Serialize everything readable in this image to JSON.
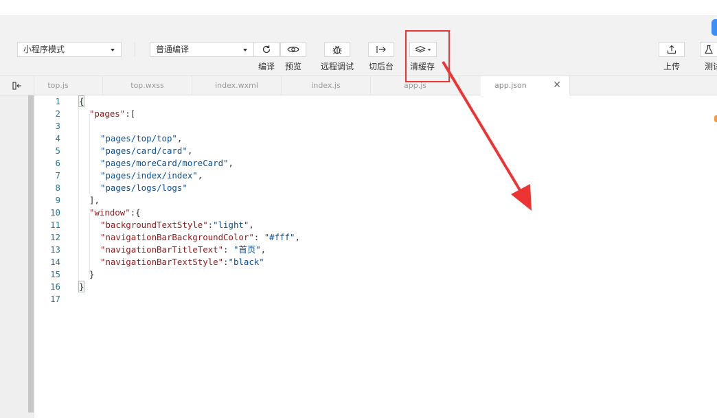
{
  "toolbar": {
    "mode_select": "小程序模式",
    "compile_select": "普通编译",
    "buttons": {
      "compile": "编译",
      "preview": "预览",
      "remote_debug": "远程调试",
      "background": "切后台",
      "clear_cache": "清缓存",
      "upload": "上传",
      "test": "测试"
    }
  },
  "tabs": [
    {
      "label": "top.js"
    },
    {
      "label": "top.wxss"
    },
    {
      "label": "index.wxml"
    },
    {
      "label": "index.js"
    },
    {
      "label": "app.js"
    },
    {
      "label": "app.json",
      "active": true
    }
  ],
  "editor": {
    "lines": [
      {
        "num": "1",
        "text": "{"
      },
      {
        "num": "2",
        "key": "\"pages\"",
        "rest": ":["
      },
      {
        "num": "3",
        "text": ""
      },
      {
        "num": "4",
        "str": "\"pages/top/top\"",
        "rest": ","
      },
      {
        "num": "5",
        "str": "\"pages/card/card\"",
        "rest": ","
      },
      {
        "num": "6",
        "str": "\"pages/moreCard/moreCard\"",
        "rest": ","
      },
      {
        "num": "7",
        "str": "\"pages/index/index\"",
        "rest": ","
      },
      {
        "num": "8",
        "str": "\"pages/logs/logs\"",
        "rest": ""
      },
      {
        "num": "9",
        "text": "],"
      },
      {
        "num": "10",
        "key": "\"window\"",
        "rest": ":{"
      },
      {
        "num": "11",
        "key": "\"backgroundTextStyle\"",
        "sep": ":",
        "str": "\"light\"",
        "rest": ","
      },
      {
        "num": "12",
        "key": "\"navigationBarBackgroundColor\"",
        "sep": ": ",
        "str": "\"#fff\"",
        "rest": ","
      },
      {
        "num": "13",
        "key": "\"navigationBarTitleText\"",
        "sep": ": ",
        "str": "\"首页\"",
        "rest": ","
      },
      {
        "num": "14",
        "key": "\"navigationBarTextStyle\"",
        "sep": ":",
        "str": "\"black\"",
        "rest": ""
      },
      {
        "num": "15",
        "text": "}"
      },
      {
        "num": "16",
        "text": "}"
      },
      {
        "num": "17",
        "text": ""
      }
    ]
  },
  "colors": {
    "annotation": "#ee3333",
    "line_number": "#237893",
    "json_key": "#a31515",
    "json_string": "#0451a5"
  }
}
